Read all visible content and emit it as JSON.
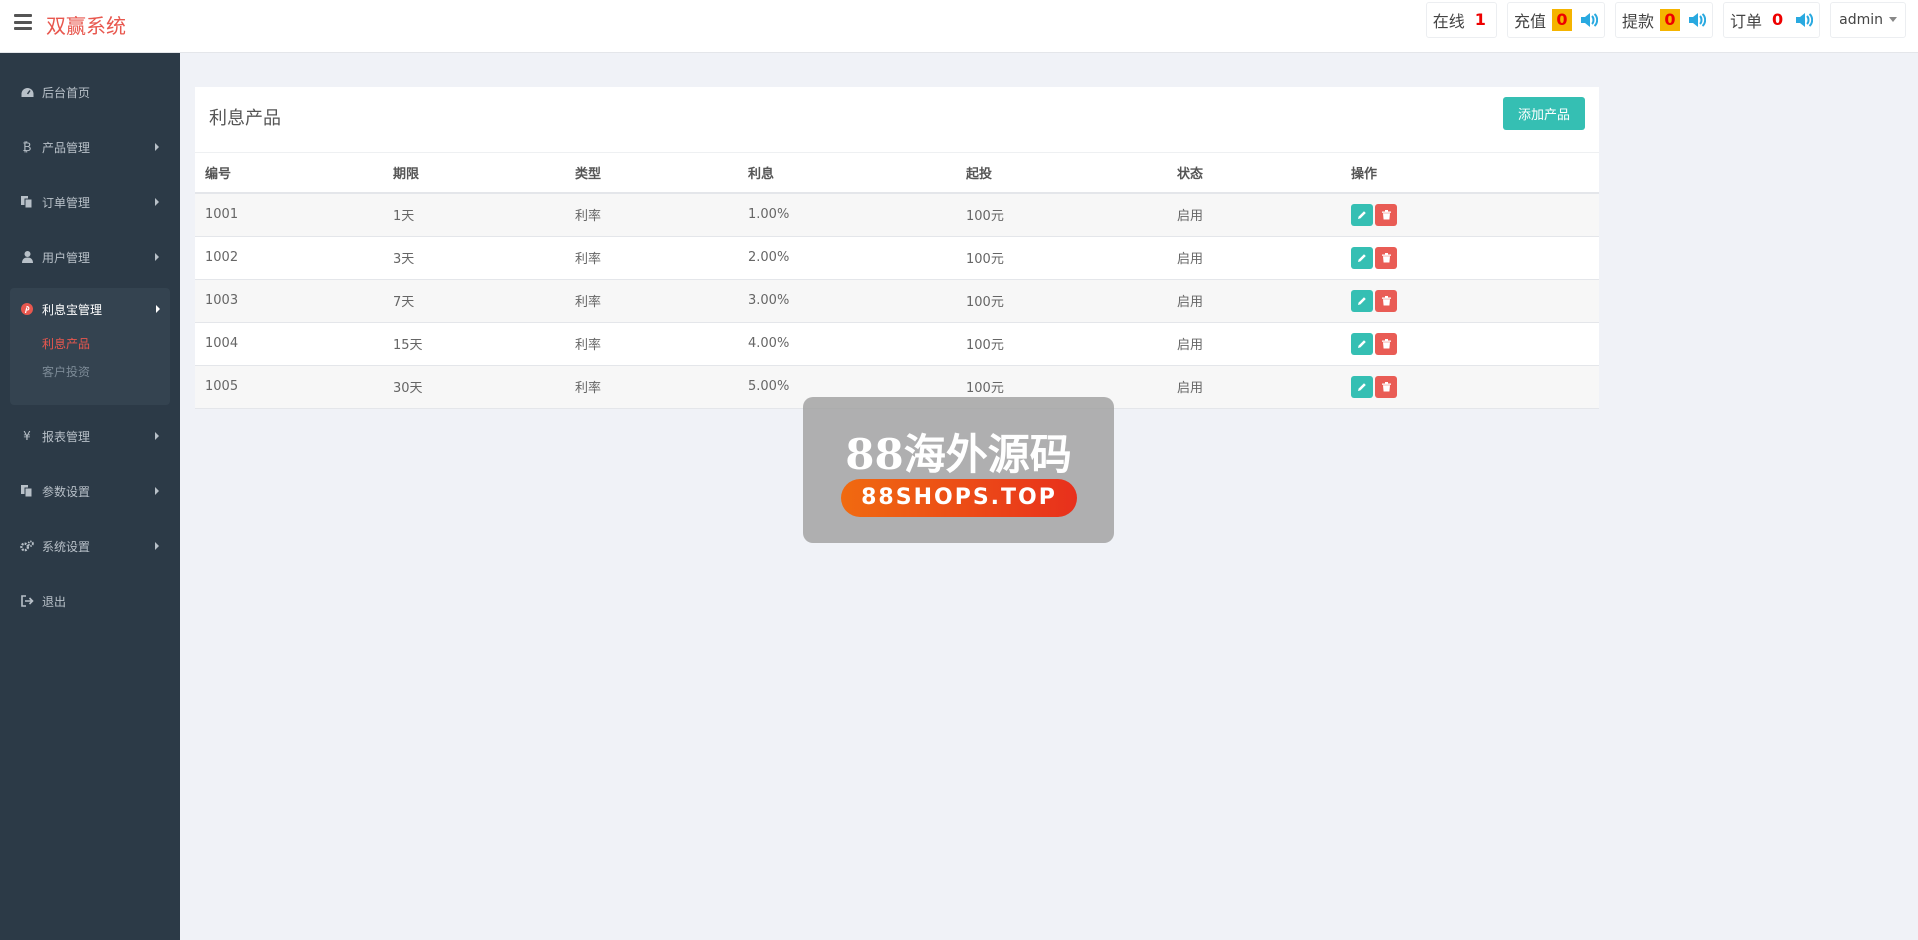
{
  "header": {
    "brand": "双赢系统",
    "stats": [
      {
        "label": "在线",
        "value": "1"
      },
      {
        "label": "充值",
        "value": "0"
      },
      {
        "label": "提款",
        "value": "0"
      },
      {
        "label": "订单",
        "value": "0"
      }
    ],
    "user": "admin"
  },
  "sidebar": {
    "items": [
      {
        "label": "后台首页",
        "icon": "dashboard-icon"
      },
      {
        "label": "产品管理",
        "icon": "bitcoin-icon"
      },
      {
        "label": "订单管理",
        "icon": "copy-icon"
      },
      {
        "label": "用户管理",
        "icon": "user-icon"
      },
      {
        "label": "利息宝管理",
        "icon": "pinterest-icon"
      },
      {
        "label": "报表管理",
        "icon": "yen-icon"
      },
      {
        "label": "参数设置",
        "icon": "files-icon"
      },
      {
        "label": "系统设置",
        "icon": "cogs-icon"
      },
      {
        "label": "退出",
        "icon": "sign-out-icon"
      }
    ],
    "submenu": [
      "利息产品",
      "客户投资"
    ]
  },
  "panel": {
    "title": "利息产品",
    "add_button": "添加产品",
    "columns": [
      "编号",
      "期限",
      "类型",
      "利息",
      "起投",
      "状态",
      "操作"
    ],
    "rows": [
      [
        "1001",
        "1天",
        "利率",
        "1.00%",
        "100元",
        "启用"
      ],
      [
        "1002",
        "3天",
        "利率",
        "2.00%",
        "100元",
        "启用"
      ],
      [
        "1003",
        "7天",
        "利率",
        "3.00%",
        "100元",
        "启用"
      ],
      [
        "1004",
        "15天",
        "利率",
        "4.00%",
        "100元",
        "启用"
      ],
      [
        "1005",
        "30天",
        "利率",
        "5.00%",
        "100元",
        "启用"
      ]
    ]
  },
  "watermark": {
    "title": "88海外源码",
    "url": "88SHOPS.TOP"
  },
  "colors": {
    "brand": "#e8574e",
    "sidebar": "#2c3a47",
    "accent": "#35bfb3",
    "danger": "#e95c55",
    "badge": "#f5b400"
  }
}
